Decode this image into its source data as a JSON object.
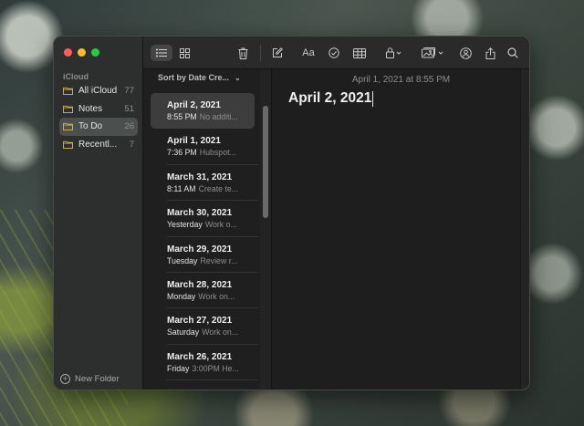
{
  "window": {
    "traffic_lights": {
      "close": "#ff5f57",
      "minimize": "#febc2e",
      "zoom": "#28c840"
    }
  },
  "sidebar": {
    "section_label": "iCloud",
    "folders": [
      {
        "label": "All iCloud",
        "count": "77",
        "selected": false
      },
      {
        "label": "Notes",
        "count": "51",
        "selected": false
      },
      {
        "label": "To Do",
        "count": "26",
        "selected": true
      },
      {
        "label": "Recentl...",
        "count": "7",
        "selected": false
      }
    ],
    "new_folder_label": "New Folder",
    "folder_icon_color": "#e5b93b"
  },
  "toolbar": {
    "icons": [
      "list-view-icon",
      "gallery-view-icon",
      "trash-icon",
      "compose-icon",
      "format-text-icon",
      "checklist-icon",
      "table-icon",
      "lock-icon",
      "media-icon",
      "collaborate-icon",
      "share-icon",
      "search-icon"
    ],
    "format_label": "Aa"
  },
  "list": {
    "sort_label": "Sort by Date Cre...",
    "notes": [
      {
        "title": "April 2, 2021",
        "time": "8:55 PM",
        "preview": "No additi...",
        "selected": true
      },
      {
        "title": "April 1, 2021",
        "time": "7:36 PM",
        "preview": "Hubspot...",
        "selected": false
      },
      {
        "title": "March 31, 2021",
        "time": "8:11 AM",
        "preview": "Create te...",
        "selected": false
      },
      {
        "title": "March 30, 2021",
        "time": "Yesterday",
        "preview": "Work o...",
        "selected": false
      },
      {
        "title": "March 29, 2021",
        "time": "Tuesday",
        "preview": "Review r...",
        "selected": false
      },
      {
        "title": "March 28, 2021",
        "time": "Monday",
        "preview": "Work on...",
        "selected": false
      },
      {
        "title": "March 27, 2021",
        "time": "Saturday",
        "preview": "Work on...",
        "selected": false
      },
      {
        "title": "March 26, 2021",
        "time": "Friday",
        "preview": "3:00PM He...",
        "selected": false
      }
    ]
  },
  "editor": {
    "date_line": "April 1, 2021 at 8:55 PM",
    "title": "April 2, 2021"
  }
}
